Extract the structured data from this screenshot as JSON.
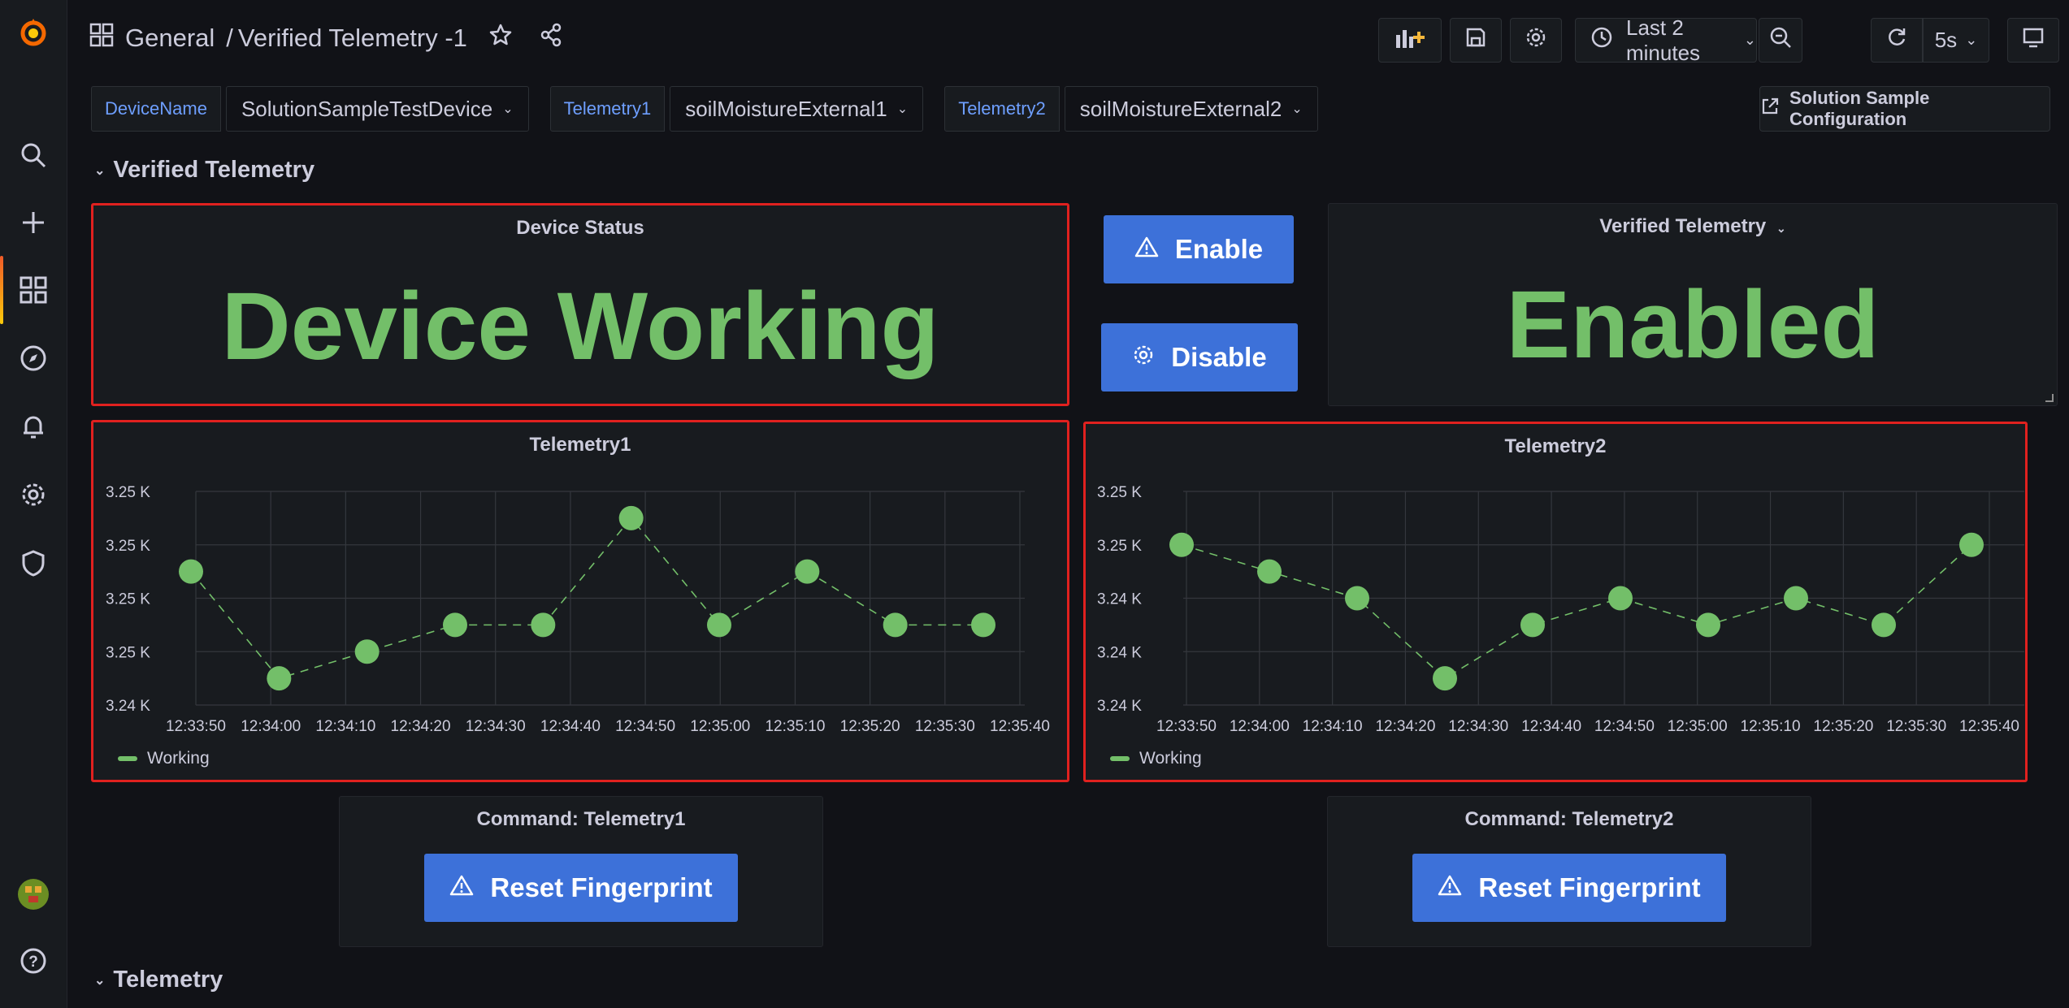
{
  "breadcrumb": {
    "folder": "General",
    "separator": "/",
    "dashboard": "Verified Telemetry -1"
  },
  "toolbar": {
    "time_range": "Last 2 minutes",
    "refresh_interval": "5s"
  },
  "variables": [
    {
      "label": "DeviceName",
      "value": "SolutionSampleTestDevice"
    },
    {
      "label": "Telemetry1",
      "value": "soilMoistureExternal1"
    },
    {
      "label": "Telemetry2",
      "value": "soilMoistureExternal2"
    }
  ],
  "config_link": "Solution Sample Configuration",
  "rows": {
    "verified": "Verified Telemetry",
    "telemetry": "Telemetry"
  },
  "device_status": {
    "title": "Device Status",
    "value": "Device Working"
  },
  "buttons": {
    "enable": "Enable",
    "disable": "Disable",
    "reset1": "Reset Fingerprint",
    "reset2": "Reset Fingerprint"
  },
  "verified_panel": {
    "title": "Verified Telemetry",
    "value": "Enabled"
  },
  "command1": {
    "title": "Command: Telemetry1"
  },
  "command2": {
    "title": "Command: Telemetry2"
  },
  "colors": {
    "accent": "#3d71d9",
    "green": "#73bf69",
    "highlight": "#e0211f",
    "link": "#6e9fff"
  },
  "chart_data": [
    {
      "type": "scatter",
      "title": "Telemetry1",
      "categories": [
        "12:33:50",
        "12:34:00",
        "12:34:10",
        "12:34:20",
        "12:34:30",
        "12:34:40",
        "12:34:50",
        "12:35:00",
        "12:35:10",
        "12:35:20",
        "12:35:30",
        "12:35:40"
      ],
      "y_tick_labels": [
        "3.25 K",
        "3.25 K",
        "3.25 K",
        "3.25 K",
        "3.24 K"
      ],
      "ylim": [
        0,
        4
      ],
      "series": [
        {
          "name": "Working",
          "values": [
            2.5,
            0.5,
            1.0,
            1.5,
            1.5,
            3.5,
            1.5,
            2.5,
            1.5,
            1.5
          ]
        }
      ],
      "x_values_index": [
        0.4,
        1.65,
        2.4,
        3.6,
        4.8,
        6.0,
        7.2,
        8.4,
        9.6,
        10.8
      ],
      "legend": "bottom-left"
    },
    {
      "type": "scatter",
      "title": "Telemetry2",
      "categories": [
        "12:33:50",
        "12:34:00",
        "12:34:10",
        "12:34:20",
        "12:34:30",
        "12:34:40",
        "12:34:50",
        "12:35:00",
        "12:35:10",
        "12:35:20",
        "12:35:30",
        "12:35:40"
      ],
      "y_tick_labels": [
        "3.25 K",
        "3.25 K",
        "3.24 K",
        "3.24 K",
        "3.24 K"
      ],
      "ylim": [
        0,
        4
      ],
      "series": [
        {
          "name": "Working",
          "values": [
            3.0,
            2.5,
            2.0,
            0.5,
            1.5,
            2.0,
            1.5,
            2.0,
            1.5,
            3.0
          ]
        }
      ],
      "legend": "bottom-left"
    }
  ]
}
